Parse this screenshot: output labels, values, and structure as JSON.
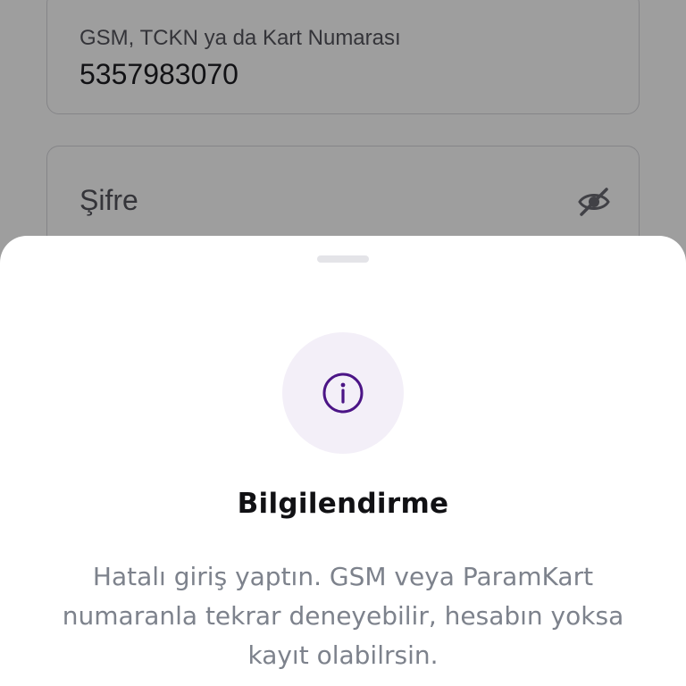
{
  "login_form": {
    "gsm_field": {
      "label": "GSM, TCKN ya da Kart Numarası",
      "value": "5357983070"
    },
    "password_field": {
      "placeholder": "Şifre",
      "toggle_icon": "eye-off-icon"
    }
  },
  "info_sheet": {
    "icon": "info-icon",
    "icon_color": "#4b1486",
    "icon_bg_color": "#f3eff8",
    "title": "Bilgilendirme",
    "message": "Hatalı giriş yaptın. GSM veya ParamKart numaranla tekrar deneyebilir, hesabın yoksa kayıt olabilrsin."
  }
}
